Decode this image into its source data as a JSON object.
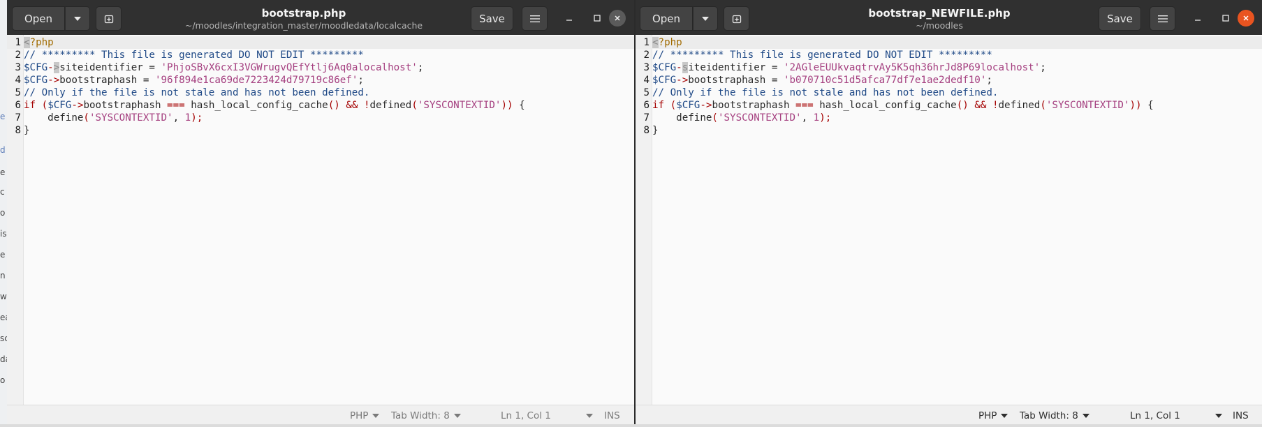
{
  "background_fragments": [
    "e",
    "d",
    "e",
    "c",
    "o",
    "is",
    "e",
    "n",
    "w",
    "ea",
    "sc",
    "da",
    "o"
  ],
  "left_window": {
    "open_label": "Open",
    "save_label": "Save",
    "title": "bootstrap.php",
    "subtitle": "~/moodles/integration_master/moodledata/localcache",
    "site_identifier": "PhjoSBvX6cxI3VGWrugvQEfYtlj6Aq0alocalhost",
    "bootstrap_hash": "96f894e1ca69de7223424d79719c86ef",
    "status": {
      "language": "PHP",
      "tab_width": "Tab Width: 8",
      "position": "Ln 1, Col 1",
      "mode": "INS"
    }
  },
  "right_window": {
    "open_label": "Open",
    "save_label": "Save",
    "title": "bootstrap_NEWFILE.php",
    "subtitle": "~/moodles",
    "site_identifier": "2AGleEUUkvaqtrvAy5K5qh36hrJd8P69localhost",
    "bootstrap_hash": "b070710c51d5afca77df7e1ae2dedf10",
    "status": {
      "language": "PHP",
      "tab_width": "Tab Width: 8",
      "position": "Ln 1, Col 1",
      "mode": "INS"
    }
  },
  "code": {
    "line_numbers": [
      "1",
      "2",
      "3",
      "4",
      "5",
      "6",
      "7",
      "8"
    ],
    "php_open_lt": "<",
    "php_open_rest": "?php",
    "comment_line2": "// ********* This file is generated DO NOT EDIT *********",
    "cfg_var": "$CFG",
    "arrow_dash": "-",
    "arrow_gt": ">",
    "arrow": "->",
    "siteid_prop": "siteidentifier",
    "siteid_prop_rest": "iteidentifier",
    "siteid_prop_first": "s",
    "bootstraphash_prop": "bootstraphash",
    "assign": "=",
    "quote": "'",
    "semicolon": ";",
    "comment_line5": "// Only if the file is not stale and has not been defined.",
    "kw_if": "if",
    "paren_open": "(",
    "paren_close": ")",
    "strict_eq": "===",
    "fn_cache": "hash_local_config_cache",
    "empty_parens": "()",
    "and_op": "&&",
    "not_op": "!",
    "fn_defined": "defined",
    "const_name": "'SYSCONTEXTID'",
    "brace_open": "{",
    "brace_close": "}",
    "fn_define": "define",
    "comma": ",",
    "one": "1",
    "close_stmt": ");",
    "close_if": "))"
  }
}
